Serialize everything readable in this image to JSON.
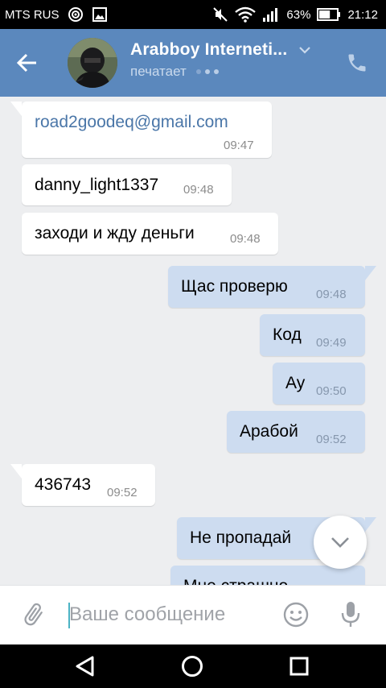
{
  "status_bar": {
    "carrier": "MTS RUS",
    "battery_percent": "63%",
    "battery_level": 0.63,
    "time": "21:12",
    "icons": [
      "target-icon",
      "image-icon",
      "mute-icon",
      "wifi-icon",
      "signal-icon",
      "battery-icon"
    ]
  },
  "header": {
    "back_icon": "arrow-left-icon",
    "title": "Arabboy Interneti...",
    "status": "печатает",
    "chevron_icon": "chevron-down-icon",
    "call_icon": "phone-icon",
    "color": "#5b88bd"
  },
  "messages": [
    {
      "direction": "in",
      "text": "road2goodeq@gmail.com",
      "time": "09:47",
      "is_link": true
    },
    {
      "direction": "in",
      "text": "danny_light1337",
      "time": "09:48"
    },
    {
      "direction": "in",
      "text": "заходи и жду деньги",
      "time": "09:48"
    },
    {
      "direction": "out",
      "text": "Щас проверю",
      "time": "09:48"
    },
    {
      "direction": "out",
      "text": "Код",
      "time": "09:49"
    },
    {
      "direction": "out",
      "text": "Ау",
      "time": "09:50"
    },
    {
      "direction": "out",
      "text": "Арабой",
      "time": "09:52"
    },
    {
      "direction": "in",
      "text": "436743",
      "time": "09:52"
    },
    {
      "direction": "out",
      "text": "Не пропадай",
      "time": ""
    },
    {
      "direction": "out",
      "text": "Мне страшно",
      "time": ""
    }
  ],
  "composer": {
    "placeholder": "Ваше сообщение",
    "value": "",
    "attach_icon": "paperclip-icon",
    "emoji_icon": "smiley-icon",
    "mic_icon": "microphone-icon"
  },
  "scroll_down_icon": "chevron-down-icon",
  "nav_bar": {
    "icons": [
      "back-triangle-icon",
      "home-circle-icon",
      "recents-square-icon"
    ]
  },
  "colors": {
    "header": "#5b88bd",
    "background": "#edeef0",
    "incoming_bubble": "#ffffff",
    "outgoing_bubble": "#cddcf0",
    "link": "#4a76a8",
    "caret": "#4bb3c4"
  }
}
